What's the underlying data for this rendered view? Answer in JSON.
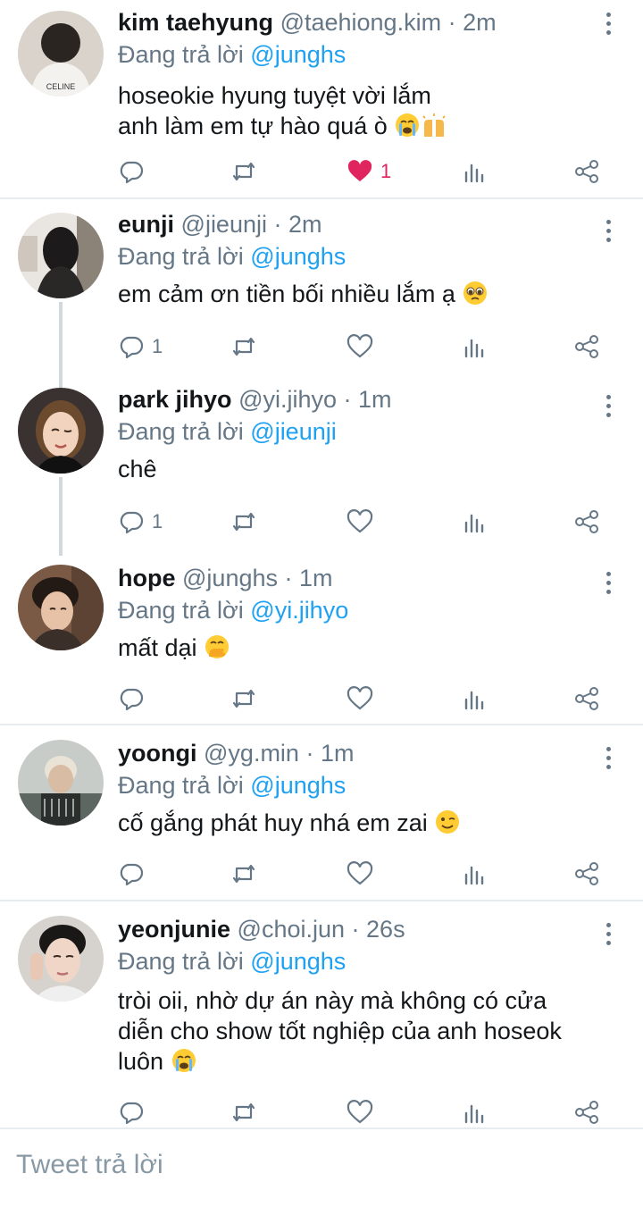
{
  "colors": {
    "link": "#1da1f2",
    "muted": "#657786",
    "like": "#e0245e",
    "divider": "#e6ecf0"
  },
  "tweets": [
    {
      "name": "kim taehyung",
      "handle": "@taehiong.kim",
      "time": "· 2m",
      "replying_prefix": "Đang trả lời",
      "replying_to": "@junghs",
      "lines": [
        "hoseokie hyung tuyệt vời lắm",
        "anh làm em tự hào quá ò"
      ],
      "emoji": [
        "loudly-crying-face",
        "raising-hands"
      ],
      "reply_count": "",
      "like_count": "1",
      "liked": true
    },
    {
      "name": "eunji",
      "handle": "@jieunji",
      "time": "· 2m",
      "replying_prefix": "Đang trả lời",
      "replying_to": "@junghs",
      "lines": [
        "em cảm ơn tiền bối nhiều lắm ạ"
      ],
      "emoji": [
        "pleading-face"
      ],
      "reply_count": "1",
      "like_count": "",
      "liked": false
    },
    {
      "name": "park jihyo",
      "handle": "@yi.jihyo",
      "time": "· 1m",
      "replying_prefix": "Đang trả lời",
      "replying_to": "@jieunji",
      "lines": [
        "chê"
      ],
      "emoji": [],
      "reply_count": "1",
      "like_count": "",
      "liked": false
    },
    {
      "name": "hope",
      "handle": "@junghs",
      "time": "· 1m",
      "replying_prefix": "Đang trả lời",
      "replying_to": "@yi.jihyo",
      "lines": [
        "mất dại"
      ],
      "emoji": [
        "face-with-hand-over-mouth"
      ],
      "reply_count": "",
      "like_count": "",
      "liked": false
    },
    {
      "name": "yoongi",
      "handle": "@yg.min",
      "time": "· 1m",
      "replying_prefix": "Đang trả lời",
      "replying_to": "@junghs",
      "lines": [
        "cố gắng phát huy nhá em zai"
      ],
      "emoji": [
        "winking-face"
      ],
      "reply_count": "",
      "like_count": "",
      "liked": false
    },
    {
      "name": "yeonjunie",
      "handle": "@choi.jun",
      "time": "· 26s",
      "replying_prefix": "Đang trả lời",
      "replying_to": "@junghs",
      "lines": [
        "tròi oii, nhờ dự án này mà không có cửa",
        "diễn cho show tốt nghiệp của anh hoseok",
        "luôn"
      ],
      "emoji": [
        "loudly-crying-face"
      ],
      "reply_count": "",
      "like_count": "",
      "liked": false
    }
  ],
  "reply_box": {
    "placeholder": "Tweet trả lời"
  }
}
